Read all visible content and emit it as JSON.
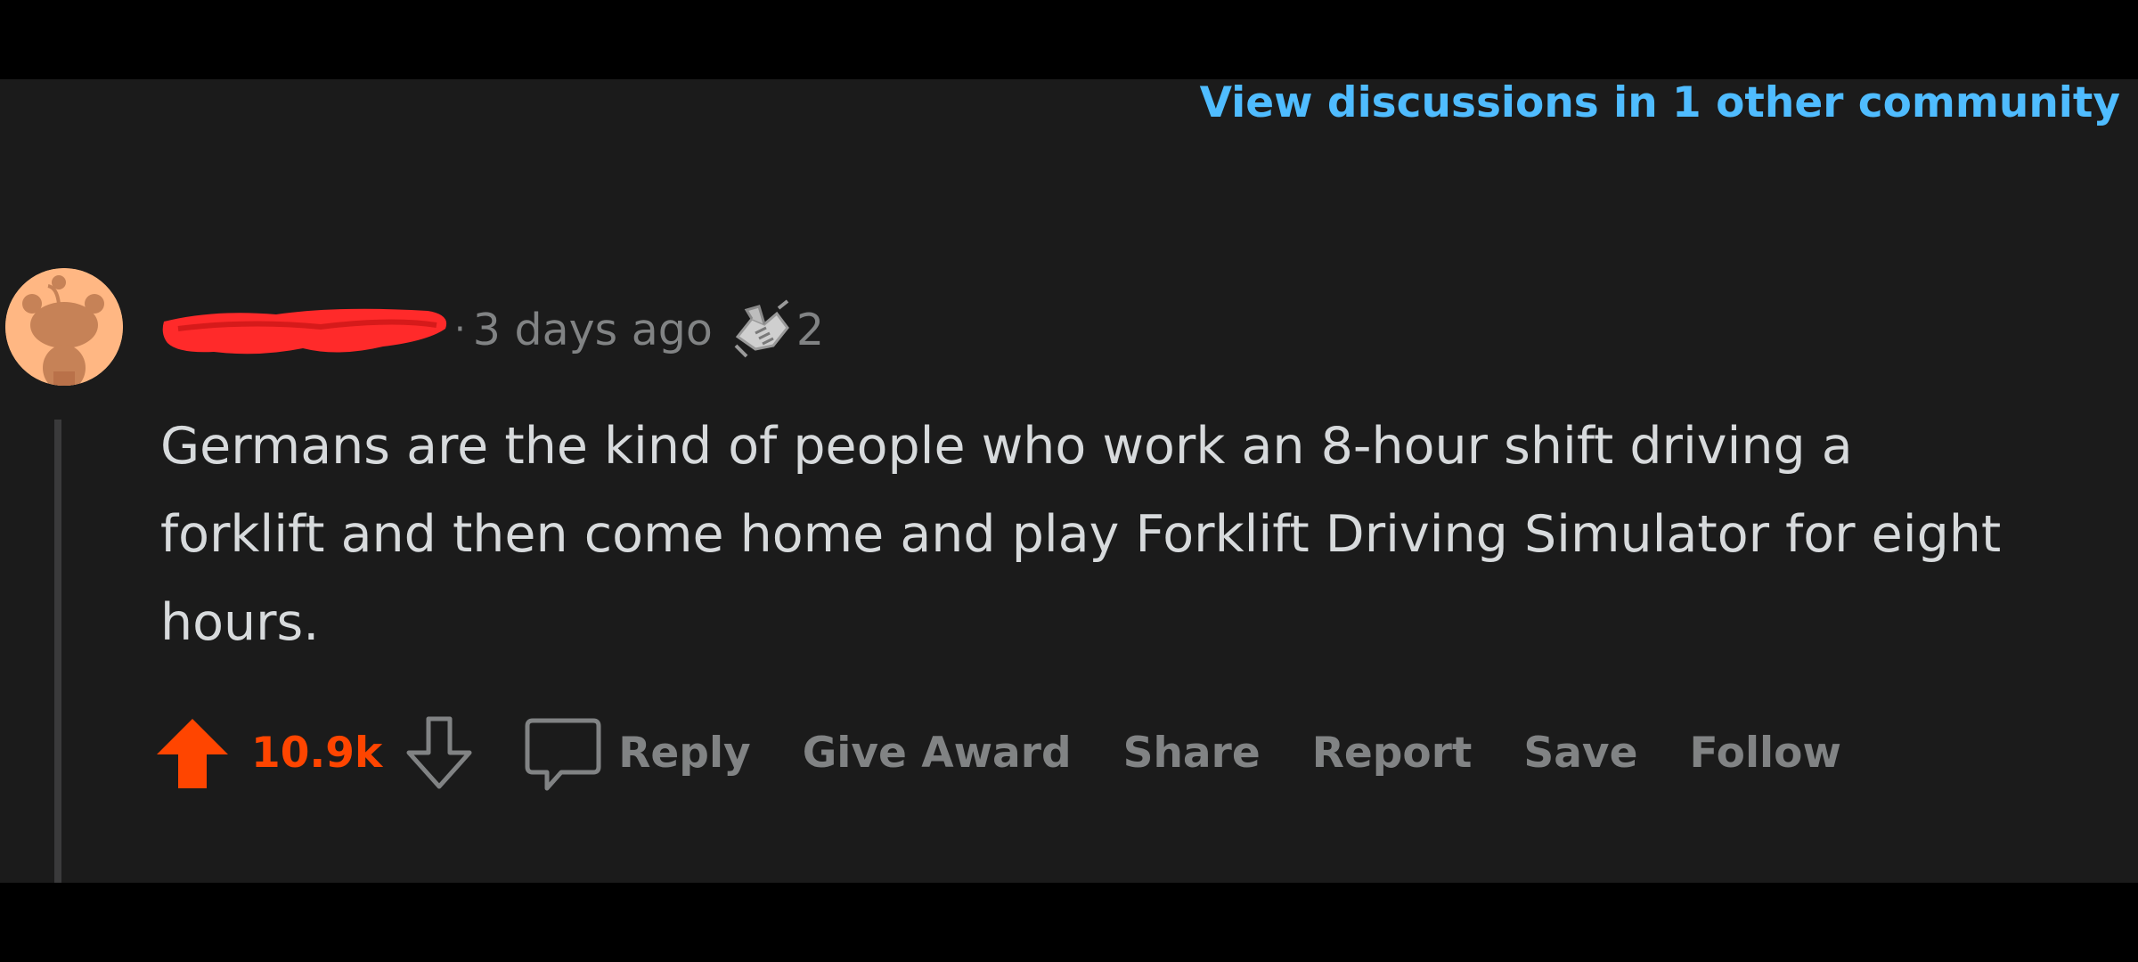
{
  "header": {
    "community_link": "View discussions in 1 other community"
  },
  "comment": {
    "timestamp": "3 days ago",
    "separator": "·",
    "award_count": "2",
    "body": "Germans are the kind of people who work an 8-hour shift driving a forklift and then come home and play Forklift Driving Simulator for eight hours.",
    "score": "10.9k",
    "vote_state": "upvoted"
  },
  "actions": {
    "reply": "Reply",
    "give_award": "Give Award",
    "share": "Share",
    "report": "Report",
    "save": "Save",
    "follow": "Follow"
  },
  "icons": {
    "avatar": "snoo-avatar-icon",
    "award": "handshake-award-icon",
    "upvote": "upvote-arrow-icon",
    "downvote": "downvote-arrow-icon",
    "reply": "comment-bubble-icon"
  },
  "colors": {
    "background": "#1b1b1b",
    "link": "#4fbcff",
    "upvote": "#ff4500",
    "muted": "#818384",
    "text": "#d7dadc",
    "username_redaction": "#ff2a2a",
    "avatar": "#ffb783"
  }
}
